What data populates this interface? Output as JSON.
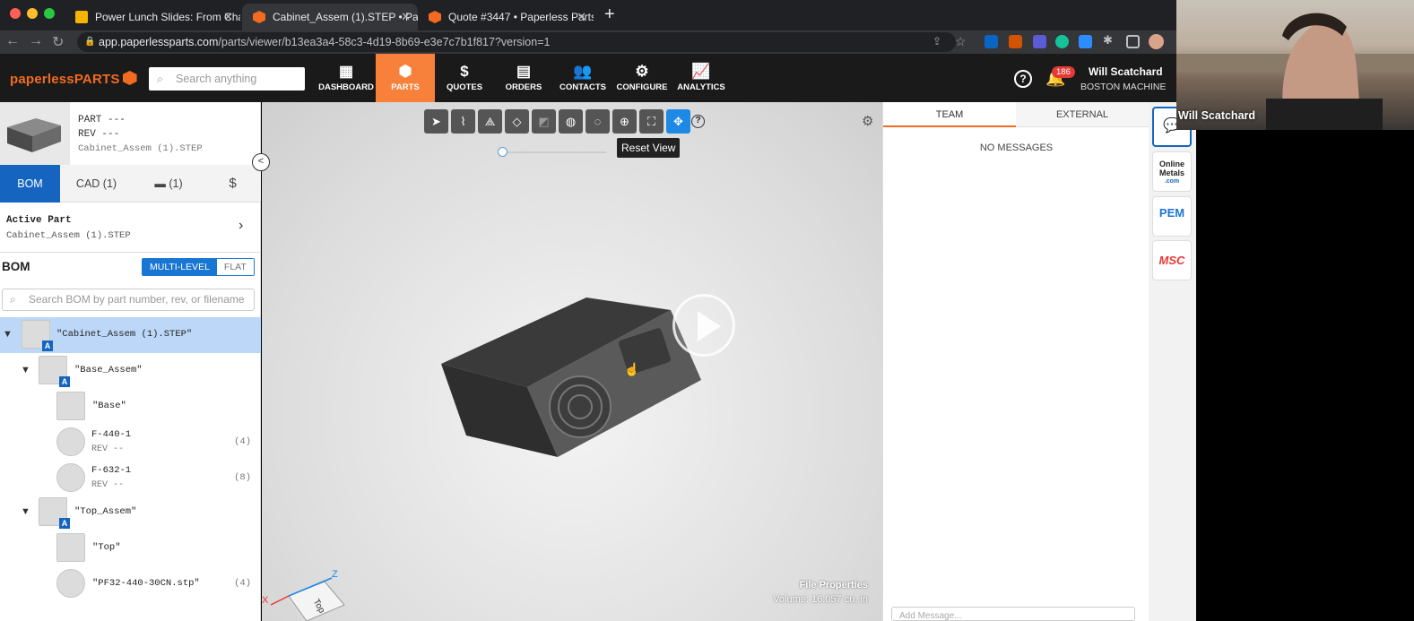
{
  "browser": {
    "tabs": [
      {
        "title": "Power Lunch Slides: From Cha",
        "color": "#f4b400"
      },
      {
        "title": "Cabinet_Assem (1).STEP • Pap",
        "color": "#f26b21"
      },
      {
        "title": "Quote #3447 • Paperless Parts",
        "color": "#f26b21"
      }
    ],
    "url_host": "app.paperlessparts.com",
    "url_path": "/parts/viewer/b13ea3a4-58c3-4d19-8b69-e3e7c7b1f817?version=1"
  },
  "app": {
    "logo": "paperlessPARTS",
    "search_placeholder": "Search anything",
    "nav": [
      {
        "label": "DASHBOARD",
        "icon": "grid-icon",
        "glyph": "▦"
      },
      {
        "label": "PARTS",
        "icon": "cube-icon",
        "glyph": "⬢"
      },
      {
        "label": "QUOTES",
        "icon": "dollar-icon",
        "glyph": "$"
      },
      {
        "label": "ORDERS",
        "icon": "clipboard-icon",
        "glyph": "▤"
      },
      {
        "label": "CONTACTS",
        "icon": "people-icon",
        "glyph": "👥"
      },
      {
        "label": "CONFIGURE",
        "icon": "gears-icon",
        "glyph": "⚙"
      },
      {
        "label": "ANALYTICS",
        "icon": "chart-icon",
        "glyph": "📈"
      }
    ],
    "notifications": "186",
    "user_name": "Will Scatchard",
    "user_company": "BOSTON MACHINE"
  },
  "part": {
    "part_label": "PART ---",
    "rev_label": "REV  ---",
    "filename": "Cabinet_Assem (1).STEP"
  },
  "left_tabs": [
    "BOM",
    "CAD (1)",
    "(1)",
    "$"
  ],
  "active_part": {
    "title": "Active Part",
    "name": "Cabinet_Assem (1).STEP"
  },
  "bom": {
    "title": "BOM",
    "mode_on": "MULTI-LEVEL",
    "mode_off": "FLAT",
    "search_placeholder": "Search BOM by part number, rev, or filename",
    "rows": [
      {
        "name": "\"Cabinet_Assem (1).STEP\"",
        "rev": "",
        "qty": ""
      },
      {
        "name": "\"Base_Assem\"",
        "rev": "",
        "qty": ""
      },
      {
        "name": "\"Base\"",
        "rev": "",
        "qty": ""
      },
      {
        "name": "F-440-1",
        "rev": "REV --",
        "qty": "(4)"
      },
      {
        "name": "F-632-1",
        "rev": "REV --",
        "qty": "(8)"
      },
      {
        "name": "\"Top_Assem\"",
        "rev": "",
        "qty": ""
      },
      {
        "name": "\"Top\"",
        "rev": "",
        "qty": ""
      },
      {
        "name": "\"PF32-440-30CN.stp\"",
        "rev": "",
        "qty": "(4)"
      }
    ]
  },
  "viewer": {
    "tooltip": "Reset View",
    "file_props_title": "File Properties",
    "volume": "Volume: 16.057 cu. in",
    "cube_face": "Top",
    "axis_x": "X",
    "axis_z": "Z"
  },
  "messages": {
    "tab_team": "TEAM",
    "tab_external": "EXTERNAL",
    "empty": "NO MESSAGES",
    "input_placeholder": "Add Message..."
  },
  "apps": [
    {
      "label": "Online Metals .com",
      "line1": "Online",
      "line2": "Metals",
      "line3": ".com"
    },
    {
      "label": "PEM",
      "line1": "PEM"
    },
    {
      "label": "MSC",
      "line1": "MSC"
    }
  ],
  "video": {
    "name": "Will Scatchard"
  },
  "colors": {
    "accent": "#f26b21",
    "primary": "#1565c0",
    "selected_row": "#bcd7f7"
  }
}
